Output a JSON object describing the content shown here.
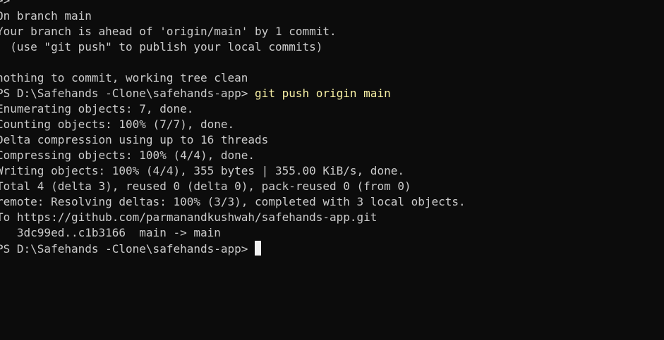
{
  "terminal": {
    "lines": [
      ">>",
      "On branch main",
      "Your branch is ahead of 'origin/main' by 1 commit.",
      "  (use \"git push\" to publish your local commits)",
      "",
      "nothing to commit, working tree clean",
      "",
      "Enumerating objects: 7, done.",
      "Counting objects: 100% (7/7), done.",
      "Delta compression using up to 16 threads",
      "Compressing objects: 100% (4/4), done.",
      "Writing objects: 100% (4/4), 355 bytes | 355.00 KiB/s, done.",
      "Total 4 (delta 3), reused 0 (delta 0), pack-reused 0 (from 0)",
      "remote: Resolving deltas: 100% (3/3), completed with 3 local objects.",
      "To https://github.com/parmanandkushwah/safehands-app.git",
      "   3dc99ed..c1b3166  main -> main"
    ],
    "prompt1": "PS D:\\Safehands -Clone\\safehands-app> ",
    "command1": "git push origin main",
    "prompt2": "PS D:\\Safehands -Clone\\safehands-app> "
  },
  "colors": {
    "background": "#0c0c0c",
    "text": "#cccccc",
    "command": "#f9f1a5",
    "cursor": "#f2f2f2"
  }
}
